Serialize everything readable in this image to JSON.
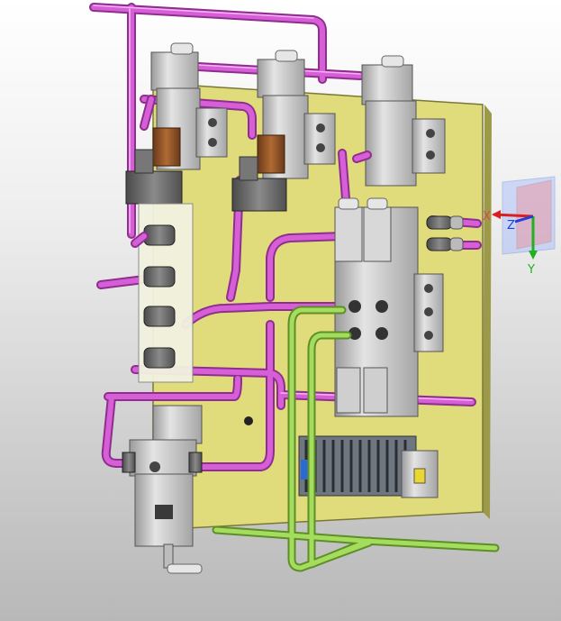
{
  "viewer": {
    "background_top": "#ffffff",
    "background_bottom": "#b8b8b8"
  },
  "colors": {
    "panel": "#e0dc7c",
    "panel_edge": "#9c9a48",
    "tube_magenta": "#cc4ccc",
    "tube_green": "#8cc846",
    "valve_gray": "#c8c8c8",
    "valve_dark": "#6e6e6e",
    "coil_brown": "#9a5a2a"
  },
  "axis_triad": {
    "x_label": "X",
    "y_label": "Y",
    "z_label": "Z",
    "icon": "axis-triad-icon"
  }
}
